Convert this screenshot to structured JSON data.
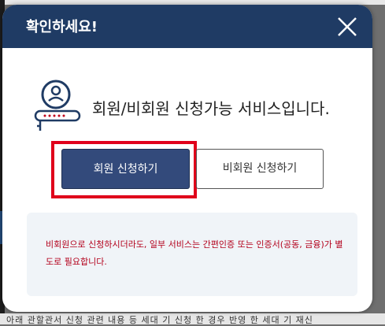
{
  "modal": {
    "title": "확인하세요!",
    "info_text": "회원/비회원 신청가능 서비스입니다.",
    "member_button_label": "회원 신청하기",
    "nonmember_button_label": "비회원 신청하기",
    "notice_text": "비회원으로 신청하시더라도, 일부 서비스는 간편인증 또는 인증서(공동, 금융)가 별도로 필요합니다."
  },
  "background": {
    "partial_text": "아래 관할관서 신청 관련 내용 등 세대 기 신청 한 경우 반영 한 세대 기 재신"
  },
  "colors": {
    "header": "#1f3b64",
    "member_button": "#334a7b",
    "highlight": "#e0001b",
    "notice_text": "#b3001b",
    "notice_bg": "#f0f4f8"
  },
  "icons": {
    "close": "close-icon",
    "person_login": "user-login-icon"
  }
}
